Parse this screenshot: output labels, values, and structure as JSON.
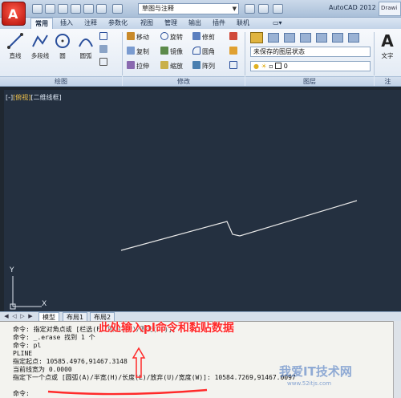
{
  "titlebar": {
    "workspace": "草图与注释",
    "app_title": "AutoCAD 2012",
    "drawing_title": "Drawi"
  },
  "tabs": [
    "常用",
    "插入",
    "注释",
    "参数化",
    "视图",
    "管理",
    "输出",
    "插件",
    "联机"
  ],
  "ribbon": {
    "draw": {
      "label": "绘图",
      "tools": [
        "直线",
        "多段线",
        "圆",
        "圆弧"
      ]
    },
    "modify": {
      "label": "修改",
      "tools": [
        [
          "移动",
          "旋转",
          "修剪"
        ],
        [
          "复制",
          "镜像",
          "圆角"
        ],
        [
          "拉伸",
          "缩放",
          "阵列"
        ]
      ]
    },
    "layers": {
      "label": "图层",
      "layer_state": "未保存的图层状态",
      "current_layer": "0"
    },
    "annotation": {
      "label": "注",
      "tool": "文字"
    }
  },
  "viewport": {
    "label_prefix": "[-]",
    "label_view": "俯视",
    "label_style": "[二维线框]"
  },
  "ucs": {
    "y": "Y",
    "x": "X"
  },
  "layout_tabs": [
    "模型",
    "布局1",
    "布局2"
  ],
  "command_lines": [
    "命令: 指定对角点或 [栏选(F)/圈围(WP)/圈交(CP)]:",
    "命令: _.erase 找到 1 个",
    "命令: pl",
    "PLINE",
    "指定起点: 10585.4976,91467.3148",
    "当前线宽为 0.0000",
    "指定下一个点或 [圆弧(A)/半宽(H)/长度(L)/放弃(U)/宽度(W)]: 10584.7269,91467.0097",
    "命令:"
  ],
  "annotation": "此处输入pl命令和黏贴数据",
  "watermark": "我爱IT技术网",
  "watermark_url": "www.52itjs.com",
  "colors": {
    "canvas": "#243040",
    "polyline": "#e8e8e8",
    "annotation": "#ff2a2a"
  }
}
